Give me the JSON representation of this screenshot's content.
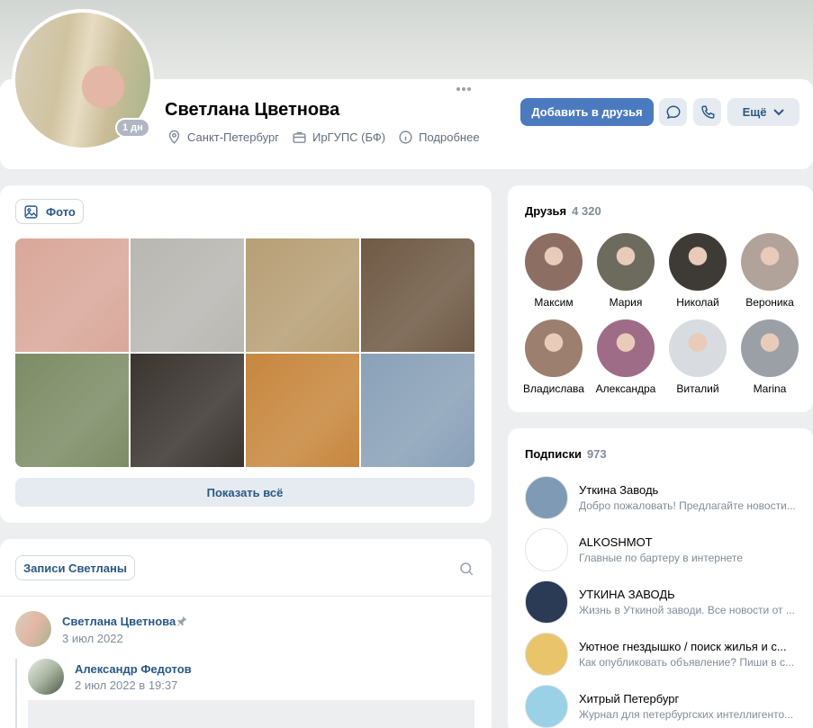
{
  "profile": {
    "name": "Светлана Цветнова",
    "online": "1 дн",
    "city": "Санкт-Петербург",
    "university": "ИрГУПС (БФ)",
    "details": "Подробнее",
    "add_friend": "Добавить в друзья",
    "more": "Ещё",
    "icons": {
      "city": "location-pin-icon",
      "university": "briefcase-icon",
      "details": "info-icon",
      "message": "chat-bubble-icon",
      "call": "phone-icon",
      "more": "chevron-down-icon"
    }
  },
  "photos": {
    "chip_label": "Фото",
    "show_all": "Показать всё",
    "colors": [
      "#d9a79a",
      "#b9b7b2",
      "#b79f76",
      "#6f5a45",
      "#7d8c66",
      "#3b3530",
      "#c7873e",
      "#8aa1b8"
    ]
  },
  "wall": {
    "chip_label": "Записи Светланы",
    "post": {
      "author": "Светлана Цветнова",
      "date": "3 июл 2022"
    },
    "repost": {
      "author": "Александр Федотов",
      "date": "2 июл 2022 в 19:37"
    }
  },
  "friends": {
    "title": "Друзья",
    "count": "4 320",
    "items": [
      {
        "name": "Максим",
        "color": "#8d6e63"
      },
      {
        "name": "Мария",
        "color": "#6d6a5e"
      },
      {
        "name": "Николай",
        "color": "#3e3a36"
      },
      {
        "name": "Вероника",
        "color": "#b1a39a"
      },
      {
        "name": "Владислава",
        "color": "#9c7f6e"
      },
      {
        "name": "Александра",
        "color": "#9e6c86"
      },
      {
        "name": "Виталий",
        "color": "#d8dbdf"
      },
      {
        "name": "Marina",
        "color": "#9aa0a6"
      }
    ]
  },
  "subscriptions": {
    "title": "Подписки",
    "count": "973",
    "items": [
      {
        "title": "Уткина Заводь",
        "desc": "Добро пожаловать! Предлагайте новости...",
        "color": "#7f9ab5"
      },
      {
        "title": "ALKOSHMOT",
        "desc": "Главные по бартеру в интернете",
        "color": "#ffffff"
      },
      {
        "title": "УТКИНА ЗАВОДЬ",
        "desc": "Жизнь в Уткиной заводи. Все новости от ...",
        "color": "#2b3a55"
      },
      {
        "title": "Уютное гнездышко / поиск жилья и с...",
        "desc": "Как опубликовать объявление? Пиши в с...",
        "color": "#e9c46a"
      },
      {
        "title": "Хитрый Петербург",
        "desc": "Журнал для петербургских интеллигенто...",
        "color": "#9ad1e6"
      }
    ]
  }
}
